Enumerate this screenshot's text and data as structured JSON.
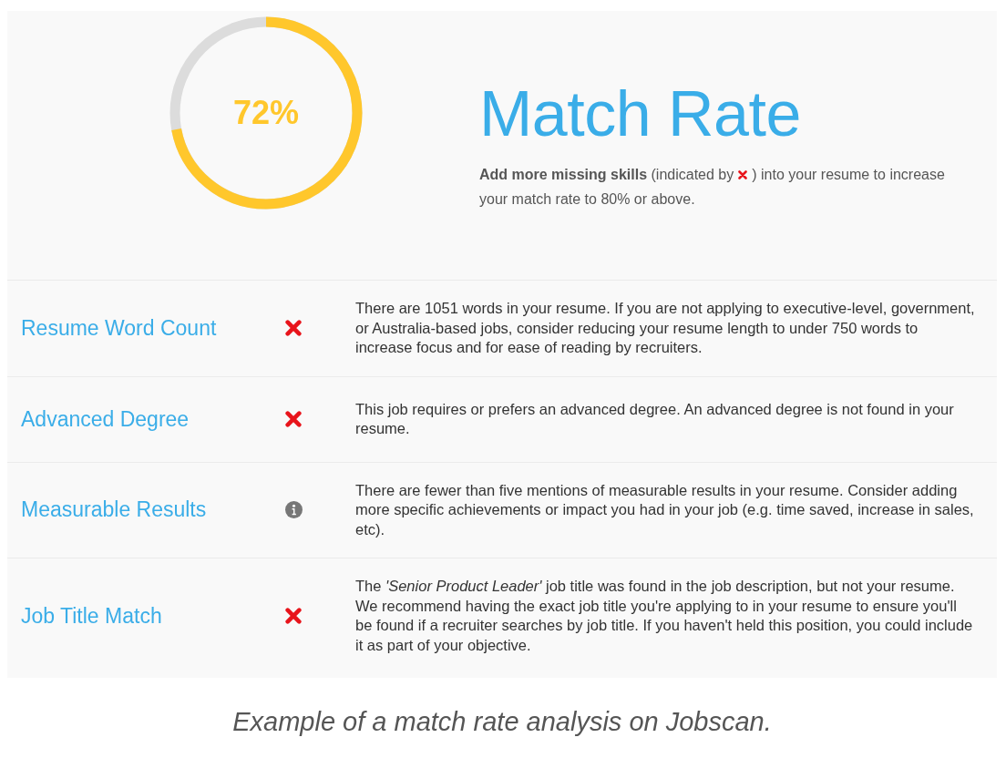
{
  "score": {
    "text": "72%",
    "level": 0.72
  },
  "heading": "Match Rate",
  "description_before": "**Add more missing skills** (indicated by",
  "description_after": ") into your resume to increase",
  "description_continued": "your match rate to 80% or above.",
  "rows": [
    {
      "label": "Resume Word Count",
      "kind": "missing",
      "text": "There are 1051 words in your resume. If you are not applying to executive-level, government, or Australia-based jobs, consider reducing your resume length to under 750 words to increase focus and for ease of reading by recruiters."
    },
    {
      "label": "Advanced Degree",
      "kind": "missing",
      "text": "This job requires or prefers an advanced degree. An advanced degree is not found in your resume."
    },
    {
      "label": "Measurable Results",
      "kind": "info",
      "text": "There are fewer than five mentions of measurable results in your resume. Consider adding more specific achievements or impact you had in your job (e.g. time saved, increase in sales, etc)."
    },
    {
      "label": "Job Title Match",
      "kind": "missing",
      "text": "The *'Senior Product Leader'* job title was found in the job description, but not your resume. We recommend having the exact job title you're applying to in your resume to ensure you'll be found if a recruiter searches by job title. If you haven't held this position, you could include it as part of your objective."
    }
  ],
  "caption": "Example of a match rate analysis on Jobscan."
}
